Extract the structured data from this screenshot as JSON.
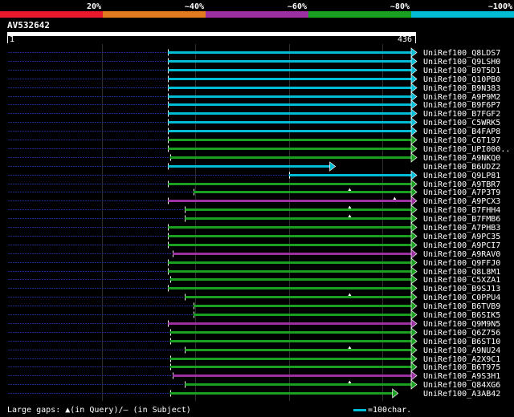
{
  "chart_data": {
    "type": "alignment",
    "query_id": "AV532642",
    "query_start": "1",
    "query_end": "436",
    "query_length": 436,
    "identity_scale": [
      {
        "label": "20%",
        "color": "#e8192c"
      },
      {
        "label": "~40%",
        "color": "#e07b20"
      },
      {
        "label": "~60%",
        "color": "#9c30a0"
      },
      {
        "label": "~80%",
        "color": "#1aa020"
      },
      {
        "label": "~100%",
        "color": "#00bcd4"
      }
    ],
    "hits": [
      {
        "name": "UniRef100_Q8LDS7",
        "start": 172,
        "end": 436,
        "color": "#00bcd4",
        "gaps": []
      },
      {
        "name": "UniRef100_Q9LSH0",
        "start": 172,
        "end": 436,
        "color": "#00bcd4",
        "gaps": []
      },
      {
        "name": "UniRef100_B9T5D1",
        "start": 172,
        "end": 436,
        "color": "#00bcd4",
        "gaps": []
      },
      {
        "name": "UniRef100_Q10PB0",
        "start": 172,
        "end": 436,
        "color": "#00bcd4",
        "gaps": []
      },
      {
        "name": "UniRef100_B9N383",
        "start": 172,
        "end": 436,
        "color": "#00bcd4",
        "gaps": []
      },
      {
        "name": "UniRef100_A9P9M2",
        "start": 172,
        "end": 436,
        "color": "#00bcd4",
        "gaps": []
      },
      {
        "name": "UniRef100_B9F6P7",
        "start": 172,
        "end": 436,
        "color": "#00bcd4",
        "gaps": []
      },
      {
        "name": "UniRef100_B7FGF2",
        "start": 172,
        "end": 436,
        "color": "#00bcd4",
        "gaps": []
      },
      {
        "name": "UniRef100_C5WRK5",
        "start": 172,
        "end": 436,
        "color": "#00bcd4",
        "gaps": []
      },
      {
        "name": "UniRef100_B4FAP8",
        "start": 172,
        "end": 436,
        "color": "#00bcd4",
        "gaps": []
      },
      {
        "name": "UniRef100_C6T197",
        "start": 172,
        "end": 436,
        "color": "#1aa020",
        "gaps": []
      },
      {
        "name": "UniRef100_UPI000..",
        "start": 172,
        "end": 436,
        "color": "#1aa020",
        "gaps": []
      },
      {
        "name": "UniRef100_A9NKQ0",
        "start": 174,
        "end": 436,
        "color": "#1aa020",
        "gaps": []
      },
      {
        "name": "UniRef100_B6UDZ2",
        "start": 172,
        "end": 349,
        "color": "#00bcd4",
        "gaps": []
      },
      {
        "name": "UniRef100_Q9LP81",
        "start": 301,
        "end": 436,
        "color": "#00bcd4",
        "gaps": []
      },
      {
        "name": "UniRef100_A9TBR7",
        "start": 172,
        "end": 436,
        "color": "#1aa020",
        "gaps": []
      },
      {
        "name": "UniRef100_A7P3T9",
        "start": 199,
        "end": 436,
        "color": "#1aa020",
        "gaps": [
          366
        ]
      },
      {
        "name": "UniRef100_A9PCX3",
        "start": 172,
        "end": 436,
        "color": "#9c30a0",
        "gaps": [
          414
        ]
      },
      {
        "name": "UniRef100_B7FHH4",
        "start": 190,
        "end": 436,
        "color": "#1aa020",
        "gaps": [
          366
        ]
      },
      {
        "name": "UniRef100_B7FMB6",
        "start": 190,
        "end": 436,
        "color": "#1aa020",
        "gaps": [
          366
        ]
      },
      {
        "name": "UniRef100_A7PHB3",
        "start": 172,
        "end": 436,
        "color": "#1aa020",
        "gaps": []
      },
      {
        "name": "UniRef100_A9PC35",
        "start": 172,
        "end": 436,
        "color": "#1aa020",
        "gaps": []
      },
      {
        "name": "UniRef100_A9PCI7",
        "start": 172,
        "end": 436,
        "color": "#1aa020",
        "gaps": []
      },
      {
        "name": "UniRef100_A9RAV0",
        "start": 177,
        "end": 436,
        "color": "#9c30a0",
        "gaps": []
      },
      {
        "name": "UniRef100_Q9FFJ0",
        "start": 172,
        "end": 436,
        "color": "#1aa020",
        "gaps": []
      },
      {
        "name": "UniRef100_Q8L8M1",
        "start": 172,
        "end": 436,
        "color": "#1aa020",
        "gaps": []
      },
      {
        "name": "UniRef100_C5XZA1",
        "start": 174,
        "end": 436,
        "color": "#1aa020",
        "gaps": []
      },
      {
        "name": "UniRef100_B9SJ13",
        "start": 172,
        "end": 436,
        "color": "#1aa020",
        "gaps": []
      },
      {
        "name": "UniRef100_C0PPU4",
        "start": 190,
        "end": 436,
        "color": "#1aa020",
        "gaps": [
          366
        ]
      },
      {
        "name": "UniRef100_B6TVB9",
        "start": 199,
        "end": 436,
        "color": "#1aa020",
        "gaps": []
      },
      {
        "name": "UniRef100_B6SIK5",
        "start": 199,
        "end": 436,
        "color": "#1aa020",
        "gaps": []
      },
      {
        "name": "UniRef100_Q9M9N5",
        "start": 172,
        "end": 436,
        "color": "#9c30a0",
        "gaps": []
      },
      {
        "name": "UniRef100_Q6Z756",
        "start": 174,
        "end": 436,
        "color": "#1aa020",
        "gaps": []
      },
      {
        "name": "UniRef100_B6ST10",
        "start": 174,
        "end": 436,
        "color": "#1aa020",
        "gaps": []
      },
      {
        "name": "UniRef100_A9NU24",
        "start": 190,
        "end": 436,
        "color": "#1aa020",
        "gaps": [
          366
        ]
      },
      {
        "name": "UniRef100_A2X9C1",
        "start": 174,
        "end": 436,
        "color": "#1aa020",
        "gaps": []
      },
      {
        "name": "UniRef100_B6T975",
        "start": 174,
        "end": 436,
        "color": "#1aa020",
        "gaps": []
      },
      {
        "name": "UniRef100_A9S3H1",
        "start": 177,
        "end": 436,
        "color": "#9c30a0",
        "gaps": []
      },
      {
        "name": "UniRef100_Q84XG6",
        "start": 190,
        "end": 436,
        "color": "#1aa020",
        "gaps": [
          366
        ]
      },
      {
        "name": "UniRef100_A3AB42",
        "start": 174,
        "end": 416,
        "color": "#1aa020",
        "gaps": []
      }
    ]
  },
  "footer": {
    "gaps_legend": "Large gaps: ▲(in Query)/– (in Subject)",
    "scale_legend": "=100char."
  }
}
